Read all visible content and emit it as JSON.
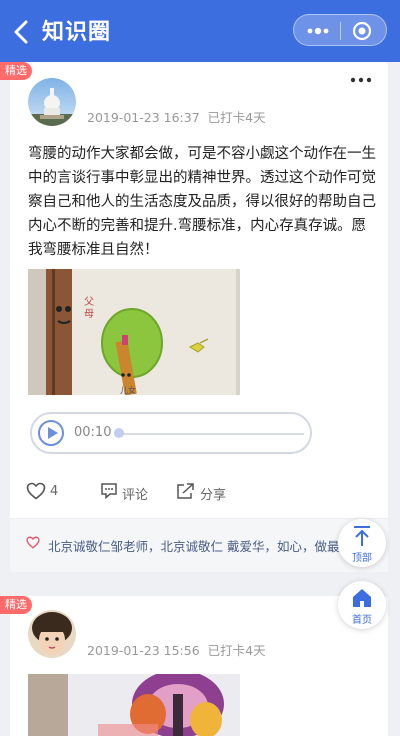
{
  "header": {
    "title": "知识圈",
    "accent": "#3d6ee0"
  },
  "posts": [
    {
      "badge": "精选",
      "meta": {
        "datetime": "2019-01-23 16:37",
        "checkin": "已打卡4天"
      },
      "text": "弯腰的动作大家都会做，可是不容小觑这个动作在一生中的言谈行事中彰显出的精神世界。透过这个动作可觉察自己和他人的生活态度及品质，得以很好的帮助自己内心不断的完善和提升.弯腰标准，内心存真存诚。愿我弯腰标准且自然！",
      "audio": {
        "time": "00:10"
      },
      "actions": {
        "likes": "4",
        "comment": "评论",
        "share": "分享"
      },
      "liked_by": "北京诚敬仁邹老师，北京诚敬仁 戴爱华，如心，做最好"
    },
    {
      "badge": "精选",
      "meta": {
        "datetime": "2019-01-23 15:56",
        "checkin": "已打卡4天"
      }
    }
  ],
  "float": {
    "top": "顶部",
    "home": "首页"
  }
}
